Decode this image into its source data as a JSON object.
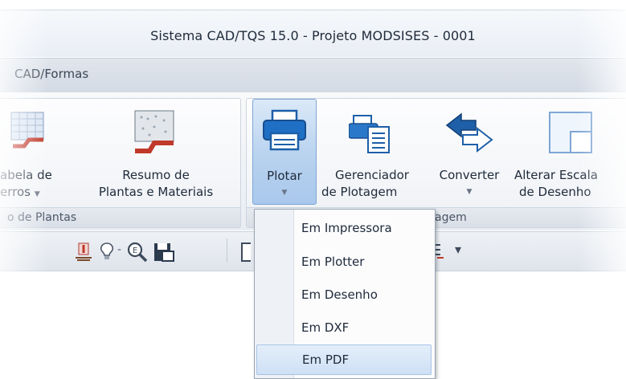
{
  "window": {
    "title": "Sistema CAD/TQS 15.0 - Projeto MODSISES - 0001"
  },
  "tabs": {
    "active": "CAD/Formas"
  },
  "ribbon": {
    "groups": {
      "plantas": {
        "label": "o de Plantas"
      },
      "plotagem": {
        "label": "agem"
      }
    },
    "buttons": {
      "tabela": {
        "line1": "abela de",
        "line2": "erros"
      },
      "resumo": {
        "line1": "Resumo de",
        "line2": "Plantas e Materiais"
      },
      "plotar": {
        "line1": "Plotar"
      },
      "gerenciador": {
        "line1": "Gerenciador",
        "line2": "de Plotagem"
      },
      "converter": {
        "line1": "Converter"
      },
      "alterar": {
        "line1": "Alterar Escala",
        "line2": "de Desenho"
      }
    },
    "dropdown_arrow": "▼"
  },
  "quick_access": {
    "dropdown": "▾"
  },
  "plot_menu": {
    "items": [
      "Em Impressora",
      "Em Plotter",
      "Em Desenho",
      "Em DXF",
      "Em PDF"
    ],
    "highlighted_index": 4
  },
  "colors": {
    "accent": "#1d5fa8",
    "highlight": "#cfe0f5"
  }
}
